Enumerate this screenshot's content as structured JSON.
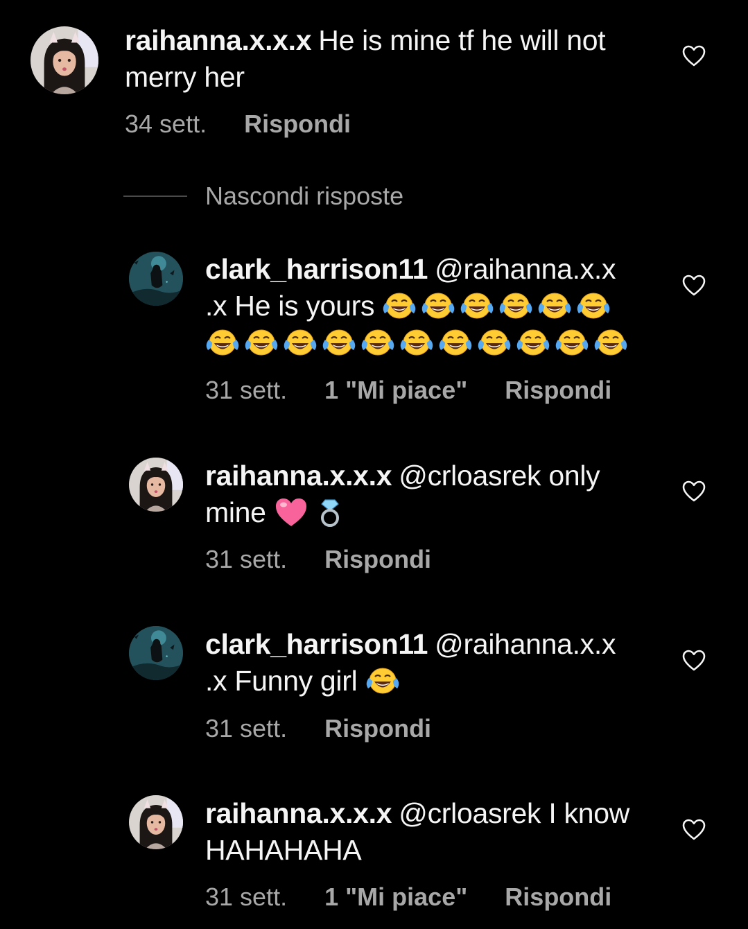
{
  "comment": {
    "username": "raihanna.x.x.x",
    "text": "He is mine tf he will not merry her",
    "line1": "He is mine tf he will not",
    "line2": "merry her",
    "time": "34 sett.",
    "reply_label": "Rispondi",
    "avatar_icon": "profile-photo-girl"
  },
  "replies_toggle": {
    "label": "Nascondi risposte"
  },
  "replies": [
    {
      "username": "clark_harrison11",
      "mention": "@raihanna.x.x",
      "line2_prefix": ".x He is yours",
      "emoji": "face-with-tears-of-joy",
      "emoji_count_line2": 6,
      "emoji_count_line3": 11,
      "time": "31 sett.",
      "likes": "1 \"Mi piace\"",
      "reply_label": "Rispondi",
      "avatar_icon": "profile-photo-dark-scene"
    },
    {
      "username": "raihanna.x.x.x",
      "mention": "@crloasrek",
      "line1_suffix": "only",
      "line2": "mine",
      "emojis": [
        "pink-heart",
        "ring"
      ],
      "time": "31 sett.",
      "reply_label": "Rispondi",
      "avatar_icon": "profile-photo-girl"
    },
    {
      "username": "clark_harrison11",
      "mention": "@raihanna.x.x",
      "line2": ".x Funny girl",
      "emoji": "face-with-tears-of-joy",
      "time": "31 sett.",
      "reply_label": "Rispondi",
      "avatar_icon": "profile-photo-dark-scene"
    },
    {
      "username": "raihanna.x.x.x",
      "mention": "@crloasrek",
      "line1_suffix": "I know",
      "line2": "HAHAHAHA",
      "time": "31 sett.",
      "likes": "1 \"Mi piace\"",
      "reply_label": "Rispondi",
      "avatar_icon": "profile-photo-girl"
    }
  ],
  "colors": {
    "background": "#000000",
    "text": "#f5f5f5",
    "meta": "#a8a8a8",
    "divider": "#4a4a4a"
  }
}
